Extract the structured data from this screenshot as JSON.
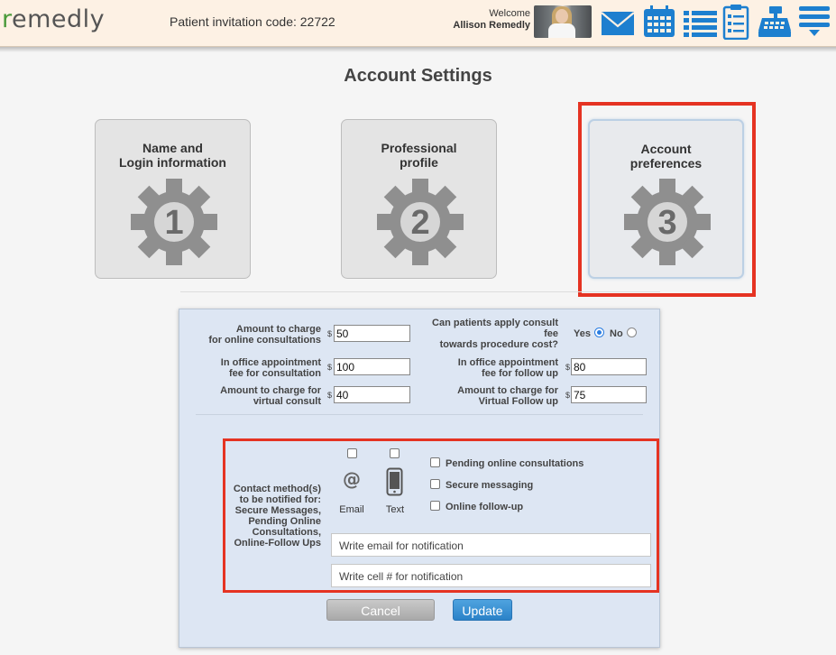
{
  "header": {
    "logo_prefix": "r",
    "logo_rest": "emedly",
    "invitation_text": "Patient invitation code: 22722",
    "welcome_label": "Welcome",
    "user_name": "Allison Remedly",
    "icons": [
      "mail-icon",
      "calendar-icon",
      "list-icon",
      "clipboard-icon",
      "cash-register-icon",
      "menu-icon"
    ],
    "icon_color": "#1d7fcf"
  },
  "page": {
    "title": "Account Settings"
  },
  "cards": [
    {
      "line1": "Name and",
      "line2": "Login information",
      "number": "1"
    },
    {
      "line1": "Professional",
      "line2": "profile",
      "number": "2"
    },
    {
      "line1": "Account",
      "line2": "preferences",
      "number": "3"
    }
  ],
  "form": {
    "online_consult": {
      "label1": "Amount to charge",
      "label2": "for online consultations",
      "currency": "$",
      "value": "50"
    },
    "office_fee": {
      "label1": "In office appointment",
      "label2": "fee for consultation",
      "currency": "$",
      "value": "100"
    },
    "virtual_consult": {
      "label1": "Amount to charge for",
      "label2": "virtual consult",
      "currency": "$",
      "value": "40"
    },
    "apply_fee": {
      "label1": "Can patients apply consult",
      "label2": "fee",
      "label3": "towards procedure cost?",
      "yes": "Yes",
      "no": "No",
      "selected": "Yes"
    },
    "office_followup": {
      "label1": "In office appointment",
      "label2": "fee for follow up",
      "currency": "$",
      "value": "80"
    },
    "virtual_followup": {
      "label1": "Amount to charge for",
      "label2": "Virtual Follow up",
      "currency": "$",
      "value": "75"
    },
    "contact": {
      "label_lines": [
        "Contact method(s)",
        "to be notified for:",
        "Secure Messages,",
        "Pending Online",
        "Consultations,",
        "Online-Follow Ups"
      ],
      "email_label": "Email",
      "text_label": "Text",
      "email_checked": false,
      "text_checked": false,
      "options": [
        {
          "label": "Pending online consultations",
          "checked": false
        },
        {
          "label": "Secure messaging",
          "checked": false
        },
        {
          "label": "Online follow-up",
          "checked": false
        }
      ],
      "email_placeholder": "Write email for notification",
      "cell_placeholder": "Write cell # for notification"
    },
    "cancel_label": "Cancel",
    "update_label": "Update"
  },
  "highlight_color": "#e53322"
}
